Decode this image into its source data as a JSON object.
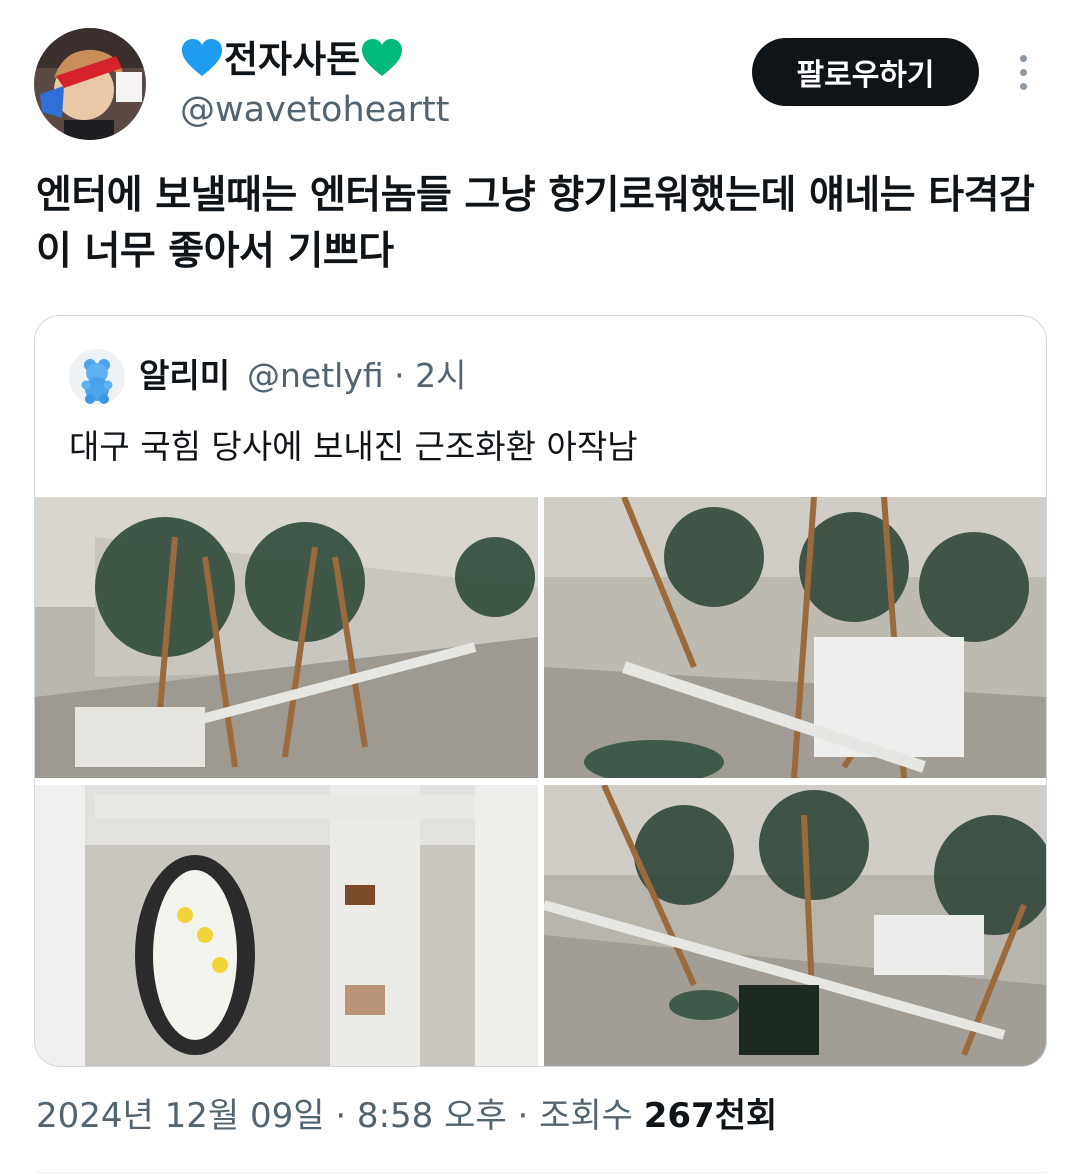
{
  "author": {
    "display_name": "전자사돈",
    "heart_left_color": "#1d9bf0",
    "heart_right_color": "#00ba7c",
    "handle": "@wavetoheartt"
  },
  "actions": {
    "follow_label": "팔로우하기",
    "more_icon": "more-vertical-icon"
  },
  "tweet": {
    "text": "엔터에 보낼때는 엔터놈들 그냥 향기로워했는데 얘네는 타격감이 너무 좋아서 기쁘다"
  },
  "quoted": {
    "display_name": "알리미",
    "meta": "@netlyfi · 2시",
    "text": "대구 국힘 당사에 보내진 근조화환 아작남",
    "photos": [
      "wreaths-fallen-1",
      "wreaths-fallen-2",
      "funeral-wreath-closeup",
      "wreaths-fallen-3"
    ]
  },
  "footer": {
    "timestamp": "2024년 12월 09일 · 8:58 오후 · 조회수 ",
    "views": "267천회"
  }
}
